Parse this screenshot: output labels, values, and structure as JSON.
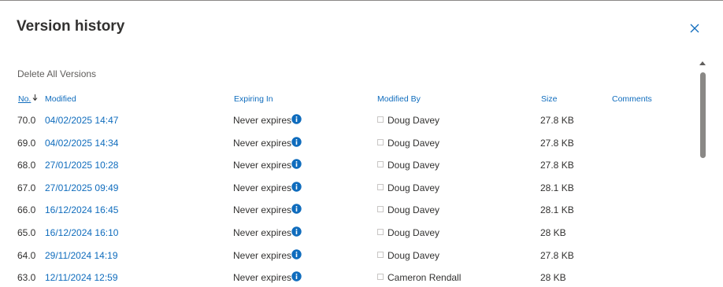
{
  "dialog": {
    "title": "Version history",
    "delete_all_label": "Delete All Versions",
    "close_icon": "close-icon"
  },
  "columns": {
    "no": "No.",
    "modified": "Modified",
    "expiring_in": "Expiring In",
    "modified_by": "Modified By",
    "size": "Size",
    "comments": "Comments"
  },
  "rows": [
    {
      "no": "70.0",
      "modified": "04/02/2025 14:47",
      "expiring": "Never expires",
      "by": "Doug Davey",
      "size": "27.8 KB"
    },
    {
      "no": "69.0",
      "modified": "04/02/2025 14:34",
      "expiring": "Never expires",
      "by": "Doug Davey",
      "size": "27.8 KB"
    },
    {
      "no": "68.0",
      "modified": "27/01/2025 10:28",
      "expiring": "Never expires",
      "by": "Doug Davey",
      "size": "27.8 KB"
    },
    {
      "no": "67.0",
      "modified": "27/01/2025 09:49",
      "expiring": "Never expires",
      "by": "Doug Davey",
      "size": "28.1 KB"
    },
    {
      "no": "66.0",
      "modified": "16/12/2024 16:45",
      "expiring": "Never expires",
      "by": "Doug Davey",
      "size": "28.1 KB"
    },
    {
      "no": "65.0",
      "modified": "16/12/2024 16:10",
      "expiring": "Never expires",
      "by": "Doug Davey",
      "size": "28 KB"
    },
    {
      "no": "64.0",
      "modified": "29/11/2024 14:19",
      "expiring": "Never expires",
      "by": "Doug Davey",
      "size": "27.8 KB"
    },
    {
      "no": "63.0",
      "modified": "12/11/2024 12:59",
      "expiring": "Never expires",
      "by": "Cameron Rendall",
      "size": "28 KB"
    }
  ],
  "colors": {
    "link": "#0f6cbd",
    "text": "#323130",
    "info_icon": "#0f6cbd"
  }
}
